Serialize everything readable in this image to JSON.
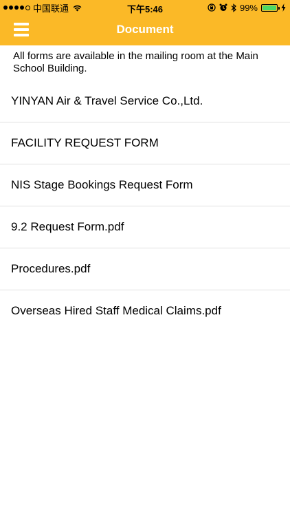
{
  "status_bar": {
    "carrier": "中国联通",
    "time": "下午5:46",
    "battery_percent": "99%",
    "battery_level": 0.99,
    "icons": [
      "signal-dots-icon",
      "wifi-icon",
      "rotation-lock-icon",
      "alarm-icon",
      "bluetooth-icon",
      "battery-icon",
      "charging-icon"
    ]
  },
  "header": {
    "title": "Document",
    "menu_icon": "hamburger-menu-icon",
    "background_color": "#fbb927",
    "title_color": "#ffffff"
  },
  "notice": "All forms are available in the mailing room at the Main School Building.",
  "documents": [
    {
      "label": "YINYAN Air & Travel Service Co.,Ltd."
    },
    {
      "label": "FACILITY REQUEST FORM"
    },
    {
      "label": "NIS Stage Bookings Request Form"
    },
    {
      "label": "9.2 Request Form.pdf"
    },
    {
      "label": "Procedures.pdf"
    },
    {
      "label": "Overseas Hired Staff Medical Claims.pdf"
    }
  ]
}
